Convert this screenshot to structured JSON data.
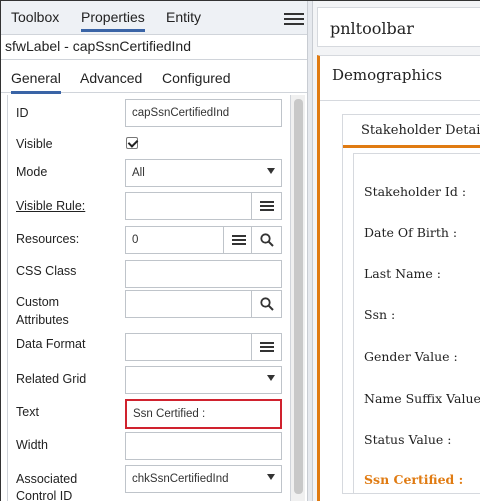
{
  "top_tabs": [
    "Toolbox",
    "Properties",
    "Entity"
  ],
  "selected_control": "sfwLabel - capSsnCertifiedInd",
  "sub_tabs": [
    "General",
    "Advanced",
    "Configured"
  ],
  "props": {
    "id": {
      "label": "ID",
      "value": "capSsnCertifiedInd"
    },
    "visible": {
      "label": "Visible",
      "checked": true
    },
    "mode": {
      "label": "Mode",
      "value": "All"
    },
    "visible_rule": {
      "label": "Visible Rule:",
      "value": ""
    },
    "resources": {
      "label": "Resources:",
      "value": "0"
    },
    "css_class": {
      "label": "CSS Class",
      "value": ""
    },
    "custom_attributes": {
      "label_1": "Custom",
      "label_2": "Attributes",
      "value": ""
    },
    "data_format": {
      "label": "Data Format",
      "value": ""
    },
    "related_grid": {
      "label": "Related Grid",
      "value": ""
    },
    "text": {
      "label": "Text",
      "value": "Ssn Certified :"
    },
    "width": {
      "label": "Width",
      "value": ""
    },
    "associated_control_id": {
      "label_1": "Associated",
      "label_2": "Control ID",
      "value": "chkSsnCertifiedInd"
    }
  },
  "preview": {
    "panel_title": "pnltoolbar",
    "section_title": "Demographics",
    "group_title": "Stakeholder Details",
    "fields": [
      "Stakeholder Id :",
      "Date Of Birth :",
      "Last Name :",
      "Ssn :",
      "Gender Value :",
      "Name Suffix Value :",
      "Status Value :",
      "Ssn Certified :"
    ]
  },
  "colors": {
    "accent": "#e07b12",
    "tab_underline": "#3a64a6",
    "highlight_box": "#d0222e"
  },
  "icons": [
    "menu-icon",
    "list-icon",
    "search-icon",
    "chevron-down-icon",
    "checkbox-checked-icon"
  ]
}
